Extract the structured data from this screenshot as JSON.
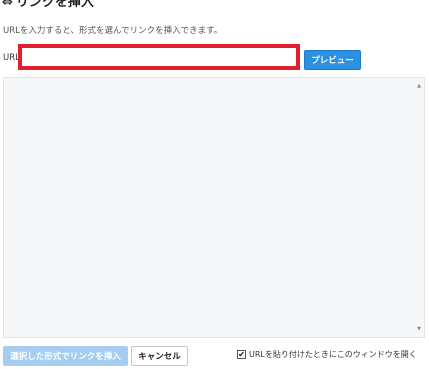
{
  "dialog": {
    "title": "リンクを挿入",
    "title_icon": "link-icon",
    "description": "URLを入力すると、形式を選んでリンクを挿入できます。",
    "url_label": "URL",
    "url_value": "",
    "preview_label": "プレビュー",
    "insert_label": "選択した形式でリンクを挿入",
    "cancel_label": "キャンセル",
    "open_window_checkbox": {
      "checked": true,
      "label": "URLを貼り付けたときにこのウィンドウを開く"
    }
  },
  "colors": {
    "highlight_border": "#e02030",
    "primary_button": "#2d8fe0",
    "disabled_button": "#a5cdef",
    "preview_background": "#f6f7f9"
  }
}
